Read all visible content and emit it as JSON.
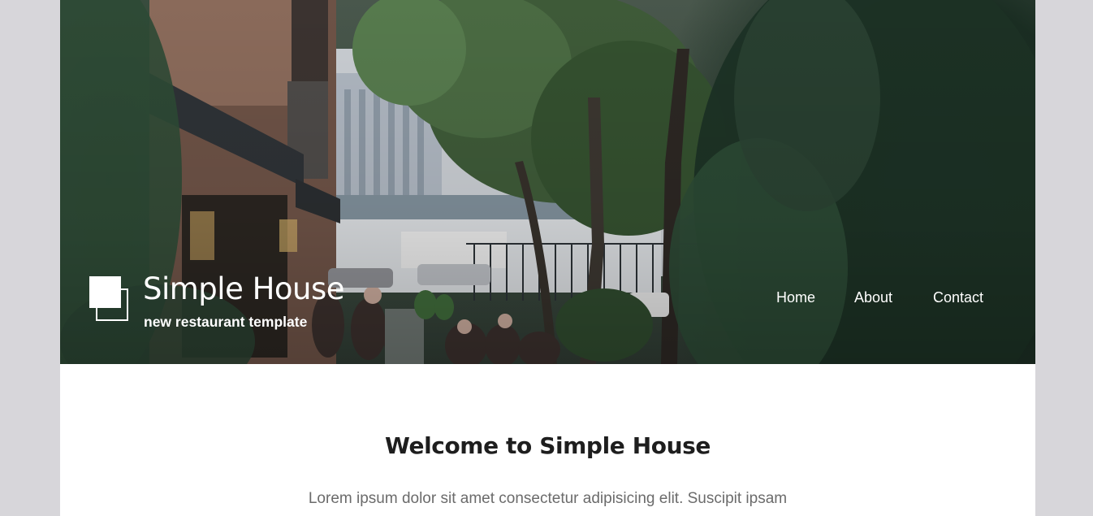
{
  "brand": {
    "title": "Simple House",
    "tagline": "new restaurant template"
  },
  "nav": {
    "items": [
      {
        "label": "Home"
      },
      {
        "label": "About"
      },
      {
        "label": "Contact"
      }
    ]
  },
  "hero": {
    "image_description_icon": "street-scene-image"
  },
  "main": {
    "heading": "Welcome to Simple House",
    "intro": "Lorem ipsum dolor sit amet consectetur adipisicing elit. Suscipit ipsam"
  },
  "colors": {
    "page_background": "#d7d6da",
    "content_background": "#ffffff",
    "hero_text": "#ffffff",
    "heading_text": "#1e1e1e",
    "body_text": "#6b6b6b"
  }
}
